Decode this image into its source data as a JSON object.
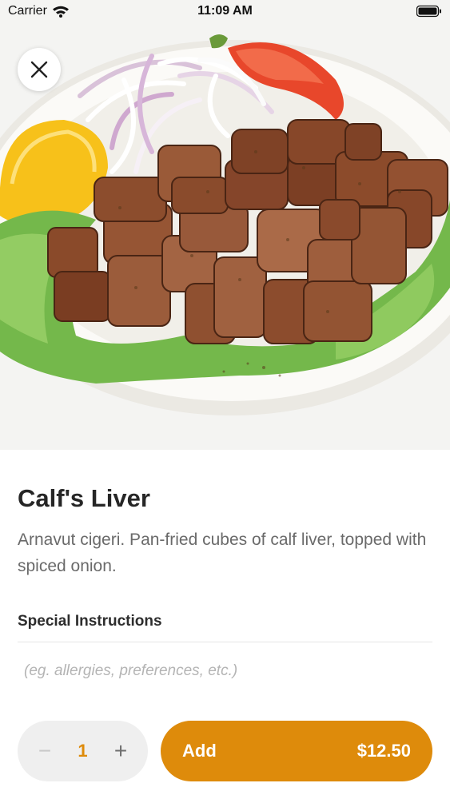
{
  "status_bar": {
    "carrier": "Carrier",
    "time": "11:09 AM"
  },
  "item": {
    "title": "Calf's Liver",
    "description": "Arnavut cigeri. Pan-fried cubes of calf liver, topped with spiced onion."
  },
  "instructions": {
    "label": "Special Instructions",
    "placeholder": "(eg. allergies, preferences, etc.)",
    "value": ""
  },
  "order": {
    "quantity": "1",
    "minus_symbol": "−",
    "plus_symbol": "+",
    "add_label": "Add",
    "price": "$12.50"
  },
  "colors": {
    "accent": "#de8b0b",
    "stepper_bg": "#efefef"
  }
}
